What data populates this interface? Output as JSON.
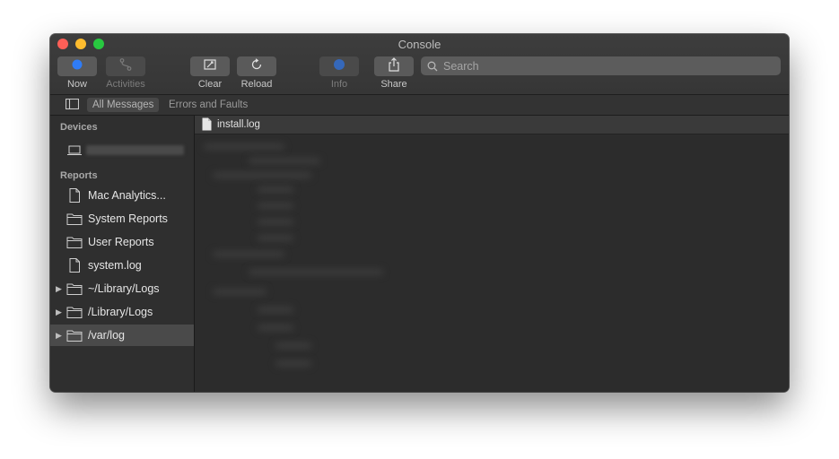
{
  "window": {
    "title": "Console"
  },
  "toolbar": {
    "now_label": "Now",
    "activities_label": "Activities",
    "clear_label": "Clear",
    "reload_label": "Reload",
    "info_label": "Info",
    "share_label": "Share",
    "search_placeholder": "Search"
  },
  "filterbar": {
    "all_messages": "All Messages",
    "errors_and_faults": "Errors and Faults"
  },
  "sidebar": {
    "devices_heading": "Devices",
    "reports_heading": "Reports",
    "items": [
      {
        "label": "Mac Analytics...",
        "icon": "document-icon"
      },
      {
        "label": "System Reports",
        "icon": "folder-icon"
      },
      {
        "label": "User Reports",
        "icon": "folder-icon"
      },
      {
        "label": "system.log",
        "icon": "document-icon"
      },
      {
        "label": "~/Library/Logs",
        "icon": "folder-icon"
      },
      {
        "label": "/Library/Logs",
        "icon": "folder-icon"
      },
      {
        "label": "/var/log",
        "icon": "folder-icon"
      }
    ]
  },
  "main": {
    "file_tab_label": "install.log"
  },
  "colors": {
    "close": "#fe5f57",
    "minimize": "#febc2e",
    "maximize": "#28c840",
    "now_accent": "#2f7cf6",
    "info_accent": "#2f7cf6"
  }
}
